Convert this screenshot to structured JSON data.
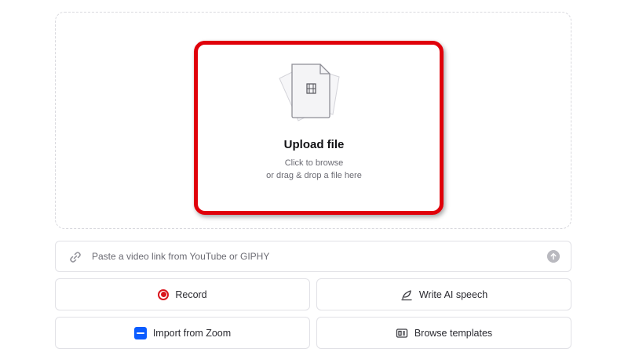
{
  "upload": {
    "title": "Upload file",
    "line1": "Click to browse",
    "line2": "or drag & drop a file here",
    "icon": "video-file-icon"
  },
  "link_bar": {
    "placeholder": "Paste a video link from YouTube or GIPHY",
    "icon": "link-icon",
    "submit_icon": "arrow-up-circle-icon"
  },
  "actions": {
    "record": {
      "label": "Record",
      "icon": "record-icon"
    },
    "speech": {
      "label": "Write AI speech",
      "icon": "feather-pen-icon"
    },
    "zoom": {
      "label": "Import from Zoom",
      "icon": "zoom-logo-icon"
    },
    "templates": {
      "label": "Browse templates",
      "icon": "template-icon"
    }
  },
  "colors": {
    "highlight": "#e0000a",
    "record": "#d9141c",
    "zoom": "#0b5cff"
  }
}
